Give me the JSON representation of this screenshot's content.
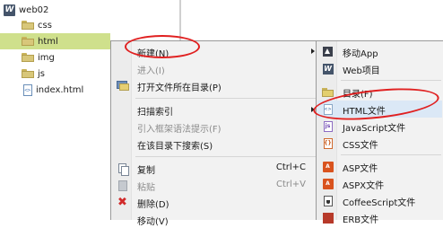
{
  "tree": {
    "project": "web02",
    "items": [
      {
        "label": "css",
        "type": "folder"
      },
      {
        "label": "html",
        "type": "folder",
        "selected": true
      },
      {
        "label": "img",
        "type": "folder"
      },
      {
        "label": "js",
        "type": "folder"
      },
      {
        "label": "index.html",
        "type": "file"
      }
    ]
  },
  "context_menu": {
    "items": [
      {
        "label": "新建(N)",
        "has_submenu": true
      },
      {
        "label": "进入(I)",
        "disabled": true
      },
      {
        "label": "打开文件所在目录(P)",
        "icon": "open-folder-icon"
      },
      {
        "label": "扫描索引",
        "has_submenu": true
      },
      {
        "label": "引入框架语法提示(F)",
        "disabled": true
      },
      {
        "label": "在该目录下搜索(S)"
      },
      {
        "label": "复制",
        "shortcut": "Ctrl+C",
        "icon": "copy-icon"
      },
      {
        "label": "粘贴",
        "shortcut": "Ctrl+V",
        "disabled": true,
        "icon": "paste-icon"
      },
      {
        "label": "删除(D)",
        "icon": "delete-icon"
      },
      {
        "label": "移动(V)"
      }
    ]
  },
  "submenu": {
    "items": [
      {
        "label": "移动App",
        "icon": "app-icon"
      },
      {
        "label": "Web项目",
        "icon": "web-project-icon"
      },
      {
        "label": "目录(F)",
        "icon": "folder-icon"
      },
      {
        "label": "HTML文件",
        "icon": "html-file-icon"
      },
      {
        "label": "JavaScript文件",
        "icon": "js-file-icon"
      },
      {
        "label": "CSS文件",
        "icon": "css-file-icon"
      },
      {
        "label": "ASP文件",
        "icon": "asp-file-icon"
      },
      {
        "label": "ASPX文件",
        "icon": "aspx-file-icon"
      },
      {
        "label": "CoffeeScript文件",
        "icon": "coffeescript-file-icon"
      },
      {
        "label": "ERB文件",
        "icon": "erb-file-icon"
      }
    ]
  },
  "annotation_color": "#e02020"
}
